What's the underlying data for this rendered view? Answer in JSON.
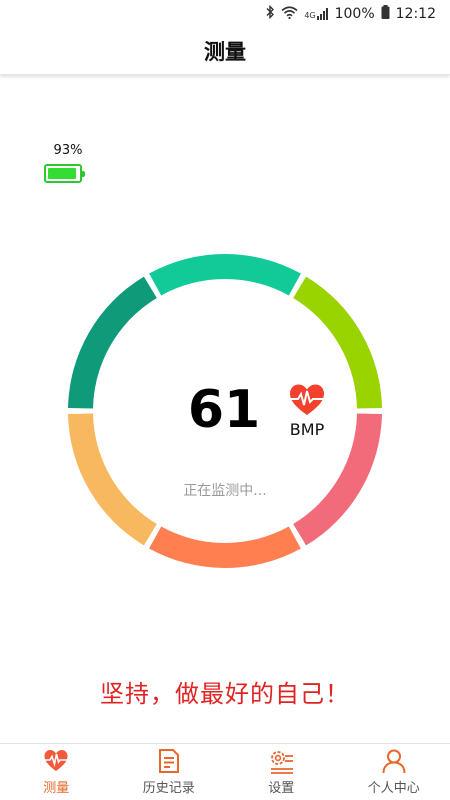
{
  "status_bar": {
    "battery": "100%",
    "time": "12:12",
    "network": "4G"
  },
  "header": {
    "title": "测量"
  },
  "device": {
    "battery_percent": "93%",
    "battery_level": 0.93
  },
  "measurement": {
    "value": "61",
    "unit": "BMP",
    "status": "正在监测中..."
  },
  "gauge_colors": [
    "#f26b7a",
    "#ff7f50",
    "#f7b85f",
    "#0f9a7a",
    "#12c998",
    "#99d300"
  ],
  "motto": "坚持，做最好的自己！",
  "nav": {
    "items": [
      {
        "label": "测量",
        "icon": "heartbeat-icon",
        "active": true
      },
      {
        "label": "历史记录",
        "icon": "history-doc-icon",
        "active": false
      },
      {
        "label": "设置",
        "icon": "settings-icon",
        "active": false
      },
      {
        "label": "个人中心",
        "icon": "user-icon",
        "active": false
      }
    ]
  }
}
